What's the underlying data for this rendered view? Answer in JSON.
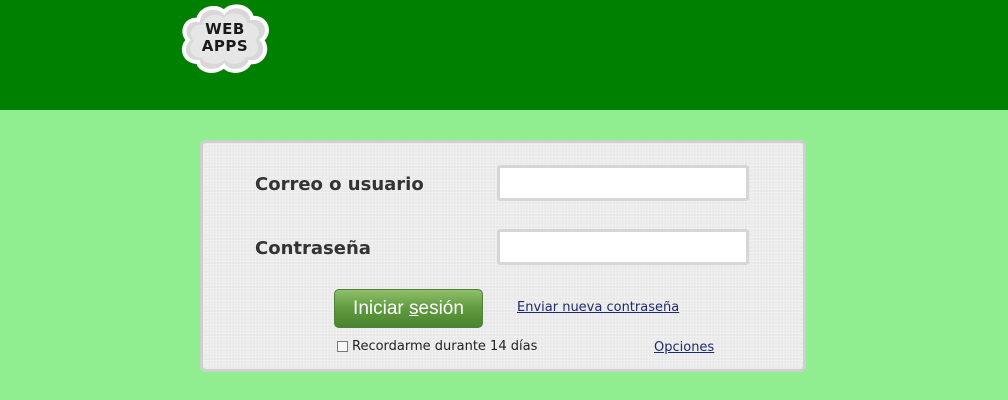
{
  "header": {
    "logo": {
      "line1": "WEB",
      "line2": "APPS"
    },
    "background": "#008000"
  },
  "page": {
    "background": "#90ee90"
  },
  "login": {
    "username_label": "Correo o usuario",
    "username_value": "",
    "password_label": "Contraseña",
    "password_value": "",
    "submit_prefix": "Iniciar ",
    "submit_underlined": "s",
    "submit_suffix": "esión",
    "reset_link": "Enviar nueva contraseña",
    "remember_label": "Recordarme durante 14 días",
    "remember_checked": false,
    "options_link": "Opciones",
    "button_color": "#5f9a3f",
    "link_color": "#1f2a6b"
  }
}
